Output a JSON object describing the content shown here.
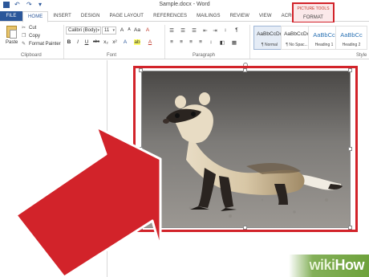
{
  "window": {
    "title": "Sample.docx - Word"
  },
  "quick_access": {
    "save_icon": "save-icon",
    "undo_icon": "undo-icon",
    "redo_icon": "redo-icon",
    "customize_icon": "customize-icon"
  },
  "tabs": [
    {
      "label": "FILE"
    },
    {
      "label": "HOME"
    },
    {
      "label": "INSERT"
    },
    {
      "label": "DESIGN"
    },
    {
      "label": "PAGE LAYOUT"
    },
    {
      "label": "REFERENCES"
    },
    {
      "label": "MAILINGS"
    },
    {
      "label": "REVIEW"
    },
    {
      "label": "VIEW"
    },
    {
      "label": "ACROBAT"
    }
  ],
  "picture_tools": {
    "context_label": "PICTURE TOOLS",
    "format_tab": "FORMAT",
    "highlight_color": "#d2232a"
  },
  "clipboard": {
    "paste": "Paste",
    "cut": "Cut",
    "copy": "Copy",
    "format_painter": "Format Painter",
    "group_label": "Clipboard"
  },
  "font": {
    "family": "Calibri (Body)",
    "size": "11",
    "group_label": "Font",
    "buttons_row1": [
      "A",
      "A",
      "Aa",
      "A"
    ],
    "buttons_row2": [
      "B",
      "I",
      "U",
      "abc",
      "x₂",
      "x²",
      "A",
      "ab",
      "A"
    ]
  },
  "paragraph": {
    "group_label": "Paragraph",
    "buttons_row1": [
      "☰",
      "☰",
      "☰",
      "⇤",
      "⇥",
      "↕",
      "¶"
    ],
    "buttons_row2": [
      "≡",
      "≡",
      "≡",
      "≡",
      "↕",
      "◧",
      "▦"
    ]
  },
  "styles": {
    "group_label": "Style",
    "items": [
      {
        "sample": "AaBbCcDc",
        "name": "¶ Normal"
      },
      {
        "sample": "AaBbCcDc",
        "name": "¶ No Spac..."
      },
      {
        "sample": "AaBbCc",
        "name": "Heading 1"
      },
      {
        "sample": "AaBbCc",
        "name": "Heading 2"
      }
    ]
  },
  "colors": {
    "accent": "#2b579a",
    "annotation_red": "#d2232a",
    "watermark_green": "#6ea23c"
  },
  "watermark": {
    "wiki": "wiki",
    "how": "How"
  }
}
